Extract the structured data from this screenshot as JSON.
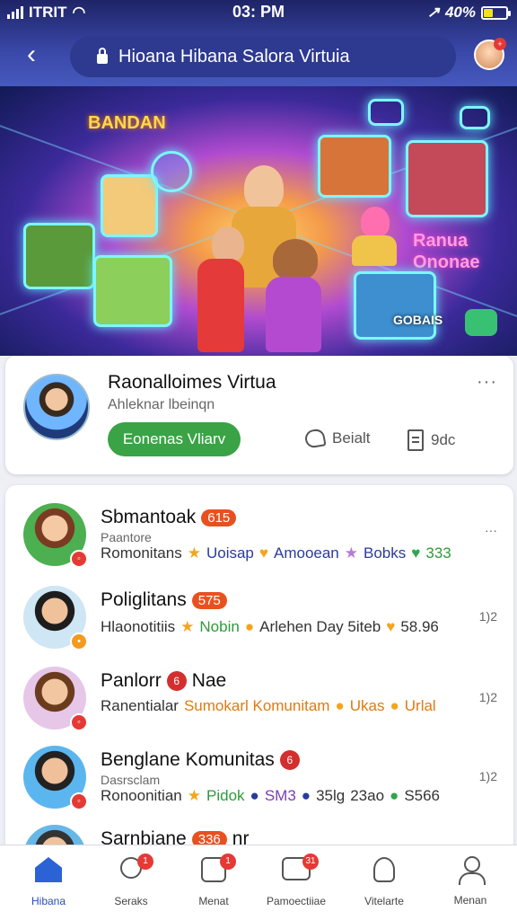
{
  "status": {
    "carrier": "ITRIT",
    "time": "03: PM",
    "battery": "40%",
    "battery_level": 0.4
  },
  "header": {
    "title": "Hioana Hibana Salora Virtuia"
  },
  "hero": {
    "neon_left": "BANDAN",
    "neon_right": "Ranua\nOnonae",
    "neon_badge": "GOBAIS"
  },
  "featured": {
    "name": "Raonalloimes Virtua",
    "subtitle": "Ahleknar lbeinqn",
    "join_label": "Eonenas Vliarv",
    "action1": "Beialt",
    "action2": "9dc",
    "more": "···"
  },
  "rows": [
    {
      "title": "Sbmantoak",
      "pill": "615",
      "meta": "Paantore",
      "line": [
        {
          "t": "Romonitans",
          "c": ""
        },
        {
          "t": "★",
          "c": "star"
        },
        {
          "t": "Uoisap",
          "c": "t-blue"
        },
        {
          "t": "♥",
          "c": "star"
        },
        {
          "t": "Amooean",
          "c": "t-blue"
        },
        {
          "t": "★",
          "c": "purple-star"
        },
        {
          "t": "Bobks",
          "c": "t-blue"
        },
        {
          "t": "♥",
          "c": "ghead"
        },
        {
          "t": "333",
          "c": "t-green"
        }
      ],
      "side": "···"
    },
    {
      "title": "Poliglitans",
      "pill": "575",
      "meta": "",
      "line": [
        {
          "t": "Hlaonotitiis",
          "c": ""
        },
        {
          "t": "★",
          "c": "star"
        },
        {
          "t": "Nobin",
          "c": "t-green"
        },
        {
          "t": "●",
          "c": "star"
        },
        {
          "t": "Arlehen Day 5iteb",
          "c": ""
        },
        {
          "t": "♥",
          "c": "star"
        },
        {
          "t": "58.96",
          "c": ""
        }
      ],
      "side": "1)2"
    },
    {
      "title": "Panlorr",
      "pill": "6",
      "extra": "Nae",
      "meta": "",
      "line": [
        {
          "t": "Ranentialar",
          "c": ""
        },
        {
          "t": "Sumokarl Komunitam",
          "c": "t-orange"
        },
        {
          "t": "●",
          "c": "star"
        },
        {
          "t": "Ukas",
          "c": "t-orange"
        },
        {
          "t": "●",
          "c": "star"
        },
        {
          "t": "Urlal",
          "c": "t-orange"
        }
      ],
      "side": "1)2"
    },
    {
      "title": "Benglane Komunitas",
      "pill": "6",
      "meta": "Dasrsclam",
      "line": [
        {
          "t": "Ronoonitian",
          "c": ""
        },
        {
          "t": "★",
          "c": "star"
        },
        {
          "t": "Pidok",
          "c": "t-green"
        },
        {
          "t": "●",
          "c": "t-blue"
        },
        {
          "t": "SM3",
          "c": "t-purple"
        },
        {
          "t": "●",
          "c": "t-blue"
        },
        {
          "t": "35lg",
          "c": ""
        },
        {
          "t": "23ao",
          "c": ""
        },
        {
          "t": "●",
          "c": "ghead"
        },
        {
          "t": "S566",
          "c": ""
        }
      ],
      "side": "1)2"
    },
    {
      "title": "Sarnbiane",
      "pill": "336",
      "extra": "nr",
      "meta": "",
      "line": [],
      "side": ""
    }
  ],
  "nav": [
    {
      "label": "Hibana",
      "icon": "home-icon",
      "badge": ""
    },
    {
      "label": "Seraks",
      "icon": "search-wand-icon",
      "badge": "1"
    },
    {
      "label": "Menat",
      "icon": "menu-card-icon",
      "badge": "1"
    },
    {
      "label": "Pamoectiiae",
      "icon": "chat-card-icon",
      "badge": "31"
    },
    {
      "label": "Vitelarte",
      "icon": "notification-icon",
      "badge": ""
    },
    {
      "label": "Menan",
      "icon": "user-icon",
      "badge": ""
    }
  ]
}
